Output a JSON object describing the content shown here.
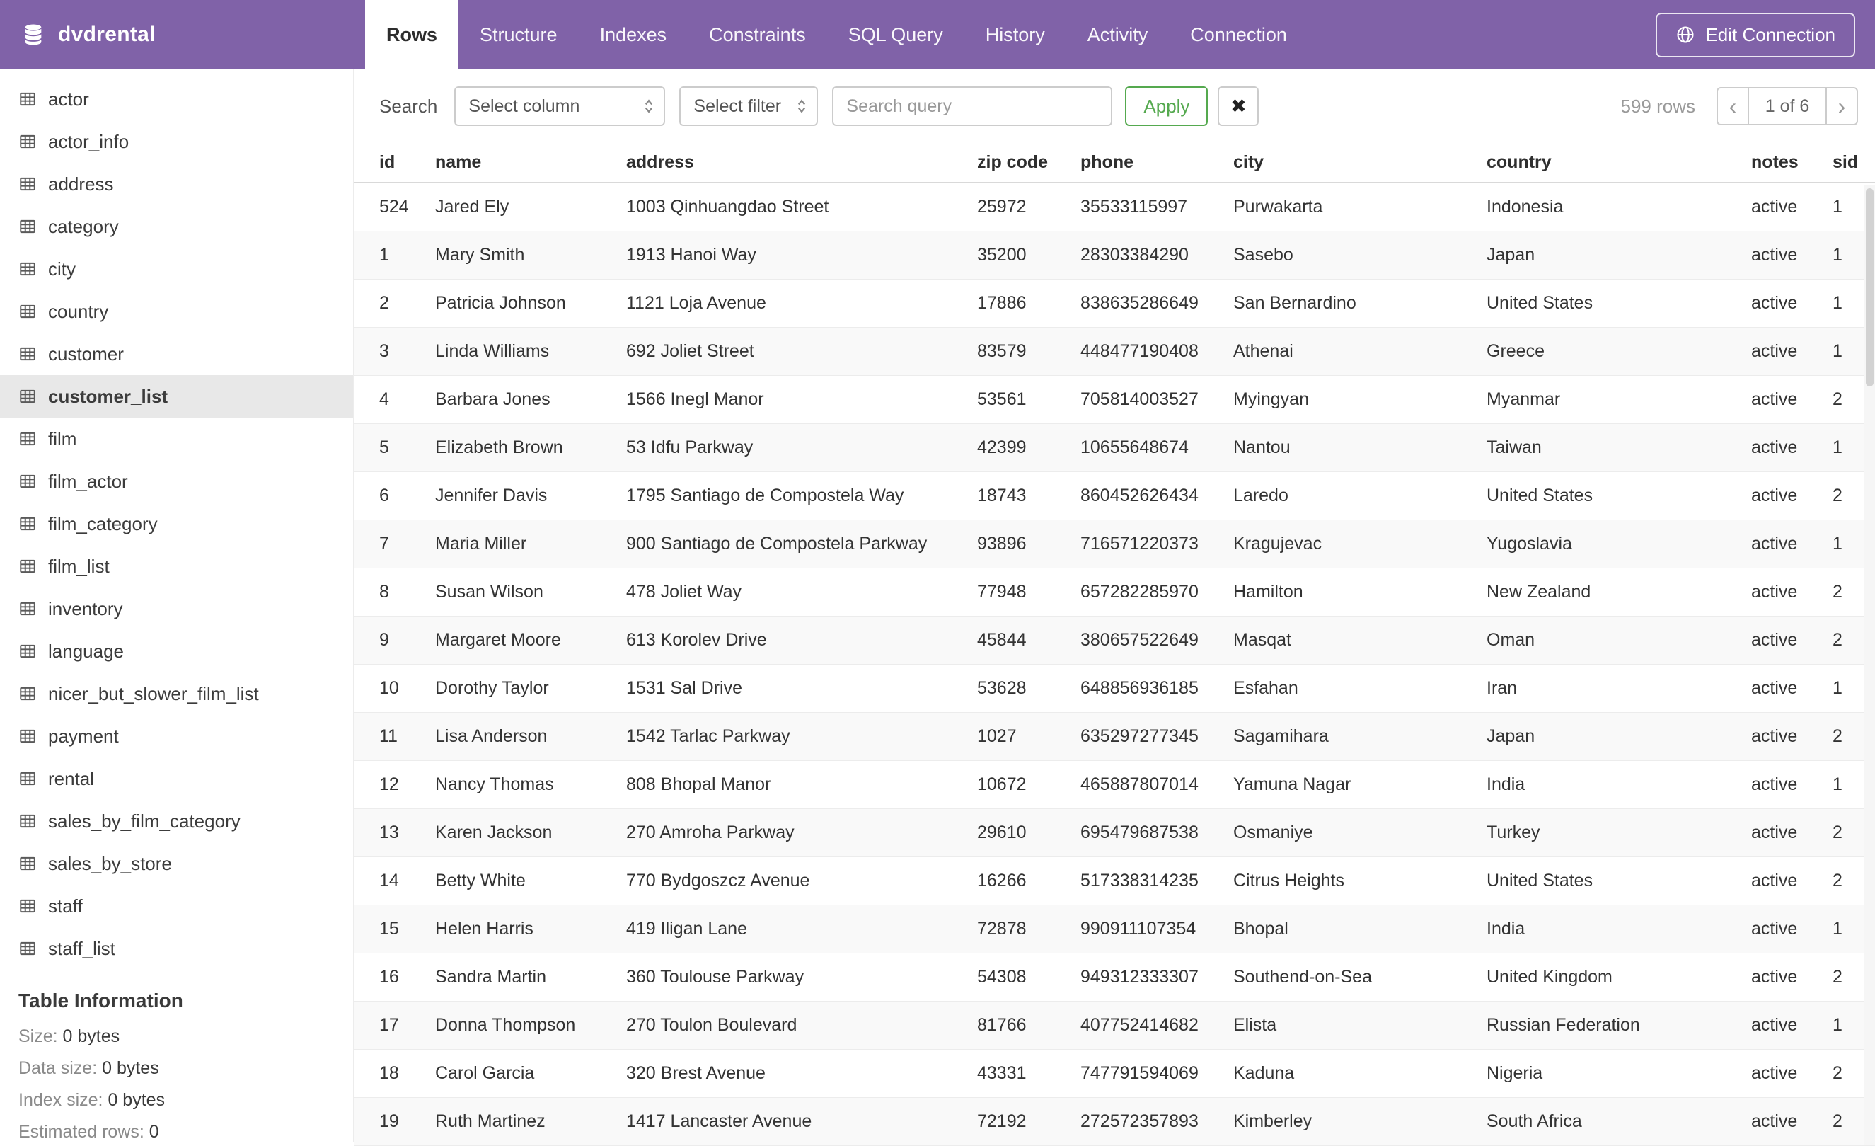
{
  "app": {
    "database": "dvdrental"
  },
  "colors": {
    "header_purple": "#8062a8",
    "apply_green": "#55a94f",
    "selected_gray": "#e8e8e8"
  },
  "header": {
    "tabs": [
      {
        "label": "Rows",
        "active": true
      },
      {
        "label": "Structure",
        "active": false
      },
      {
        "label": "Indexes",
        "active": false
      },
      {
        "label": "Constraints",
        "active": false
      },
      {
        "label": "SQL Query",
        "active": false
      },
      {
        "label": "History",
        "active": false
      },
      {
        "label": "Activity",
        "active": false
      },
      {
        "label": "Connection",
        "active": false
      }
    ],
    "edit_connection_label": "Edit Connection"
  },
  "sidebar": {
    "tables": [
      "actor",
      "actor_info",
      "address",
      "category",
      "city",
      "country",
      "customer",
      "customer_list",
      "film",
      "film_actor",
      "film_category",
      "film_list",
      "inventory",
      "language",
      "nicer_but_slower_film_list",
      "payment",
      "rental",
      "sales_by_film_category",
      "sales_by_store",
      "staff",
      "staff_list"
    ],
    "selected_table": "customer_list",
    "table_information": {
      "title": "Table Information",
      "stats": [
        {
          "label": "Size:",
          "value": "0 bytes"
        },
        {
          "label": "Data size:",
          "value": "0 bytes"
        },
        {
          "label": "Index size:",
          "value": "0 bytes"
        },
        {
          "label": "Estimated rows:",
          "value": "0"
        }
      ]
    }
  },
  "toolbar": {
    "search_label": "Search",
    "column_select": "Select column",
    "filter_select": "Select filter",
    "query_placeholder": "Search query",
    "apply_label": "Apply",
    "clear_label": "✖",
    "row_count": "599 rows",
    "pagination": {
      "prev": "‹",
      "current": "1 of 6",
      "next": "›"
    }
  },
  "table": {
    "columns": [
      "id",
      "name",
      "address",
      "zip code",
      "phone",
      "city",
      "country",
      "notes",
      "sid"
    ],
    "rows": [
      [
        "524",
        "Jared Ely",
        "1003 Qinhuangdao Street",
        "25972",
        "35533115997",
        "Purwakarta",
        "Indonesia",
        "active",
        "1"
      ],
      [
        "1",
        "Mary Smith",
        "1913 Hanoi Way",
        "35200",
        "28303384290",
        "Sasebo",
        "Japan",
        "active",
        "1"
      ],
      [
        "2",
        "Patricia Johnson",
        "1121 Loja Avenue",
        "17886",
        "838635286649",
        "San Bernardino",
        "United States",
        "active",
        "1"
      ],
      [
        "3",
        "Linda Williams",
        "692 Joliet Street",
        "83579",
        "448477190408",
        "Athenai",
        "Greece",
        "active",
        "1"
      ],
      [
        "4",
        "Barbara Jones",
        "1566 Inegl Manor",
        "53561",
        "705814003527",
        "Myingyan",
        "Myanmar",
        "active",
        "2"
      ],
      [
        "5",
        "Elizabeth Brown",
        "53 Idfu Parkway",
        "42399",
        "10655648674",
        "Nantou",
        "Taiwan",
        "active",
        "1"
      ],
      [
        "6",
        "Jennifer Davis",
        "1795 Santiago de Compostela Way",
        "18743",
        "860452626434",
        "Laredo",
        "United States",
        "active",
        "2"
      ],
      [
        "7",
        "Maria Miller",
        "900 Santiago de Compostela Parkway",
        "93896",
        "716571220373",
        "Kragujevac",
        "Yugoslavia",
        "active",
        "1"
      ],
      [
        "8",
        "Susan Wilson",
        "478 Joliet Way",
        "77948",
        "657282285970",
        "Hamilton",
        "New Zealand",
        "active",
        "2"
      ],
      [
        "9",
        "Margaret Moore",
        "613 Korolev Drive",
        "45844",
        "380657522649",
        "Masqat",
        "Oman",
        "active",
        "2"
      ],
      [
        "10",
        "Dorothy Taylor",
        "1531 Sal Drive",
        "53628",
        "648856936185",
        "Esfahan",
        "Iran",
        "active",
        "1"
      ],
      [
        "11",
        "Lisa Anderson",
        "1542 Tarlac Parkway",
        "1027",
        "635297277345",
        "Sagamihara",
        "Japan",
        "active",
        "2"
      ],
      [
        "12",
        "Nancy Thomas",
        "808 Bhopal Manor",
        "10672",
        "465887807014",
        "Yamuna Nagar",
        "India",
        "active",
        "1"
      ],
      [
        "13",
        "Karen Jackson",
        "270 Amroha Parkway",
        "29610",
        "695479687538",
        "Osmaniye",
        "Turkey",
        "active",
        "2"
      ],
      [
        "14",
        "Betty White",
        "770 Bydgoszcz Avenue",
        "16266",
        "517338314235",
        "Citrus Heights",
        "United States",
        "active",
        "2"
      ],
      [
        "15",
        "Helen Harris",
        "419 Iligan Lane",
        "72878",
        "990911107354",
        "Bhopal",
        "India",
        "active",
        "1"
      ],
      [
        "16",
        "Sandra Martin",
        "360 Toulouse Parkway",
        "54308",
        "949312333307",
        "Southend-on-Sea",
        "United Kingdom",
        "active",
        "2"
      ],
      [
        "17",
        "Donna Thompson",
        "270 Toulon Boulevard",
        "81766",
        "407752414682",
        "Elista",
        "Russian Federation",
        "active",
        "1"
      ],
      [
        "18",
        "Carol Garcia",
        "320 Brest Avenue",
        "43331",
        "747791594069",
        "Kaduna",
        "Nigeria",
        "active",
        "2"
      ],
      [
        "19",
        "Ruth Martinez",
        "1417 Lancaster Avenue",
        "72192",
        "272572357893",
        "Kimberley",
        "South Africa",
        "active",
        "2"
      ]
    ]
  }
}
